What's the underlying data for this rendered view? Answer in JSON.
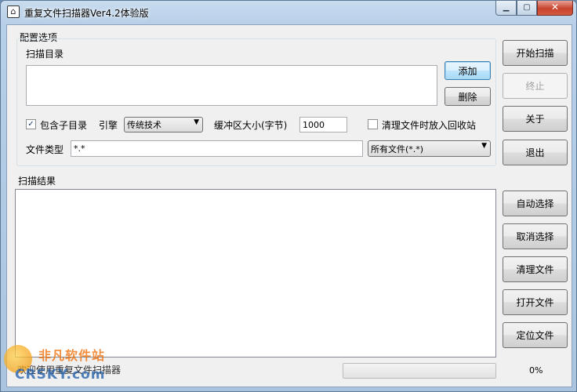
{
  "window": {
    "title": "重复文件扫描器Ver4.2体验版",
    "min_glyph": "▁",
    "max_glyph": "▢",
    "close_glyph": "✕",
    "app_icon_glyph": "⌂"
  },
  "config": {
    "group_title": "配置选项",
    "scan_dir_label": "扫描目录",
    "add_button": "添加",
    "delete_button": "删除",
    "include_subdirs_label": "包含子目录",
    "include_subdirs_checked": true,
    "engine_label": "引擎",
    "engine_value": "传统技术",
    "buffer_label": "缓冲区大小(字节)",
    "buffer_value": "1000",
    "recycle_label": "清理文件时放入回收站",
    "recycle_checked": false,
    "file_type_label": "文件类型",
    "file_type_value": "*.*",
    "file_filter_value": "所有文件(*.*)"
  },
  "results": {
    "label": "扫描结果"
  },
  "side_buttons": {
    "start": "开始扫描",
    "stop": "终止",
    "about": "关于",
    "exit": "退出",
    "auto_select": "自动选择",
    "cancel_select": "取消选择",
    "clean_files": "清理文件",
    "open_file": "打开文件",
    "locate_file": "定位文件"
  },
  "status": {
    "text": "欢迎使用重复文件扫描器",
    "progress": 0,
    "percent_text": "0%"
  },
  "watermark": {
    "cn": "非凡软件站",
    "en": "CRSKY.com"
  },
  "check_glyph": "✓",
  "dropdown_glyph": "▼"
}
